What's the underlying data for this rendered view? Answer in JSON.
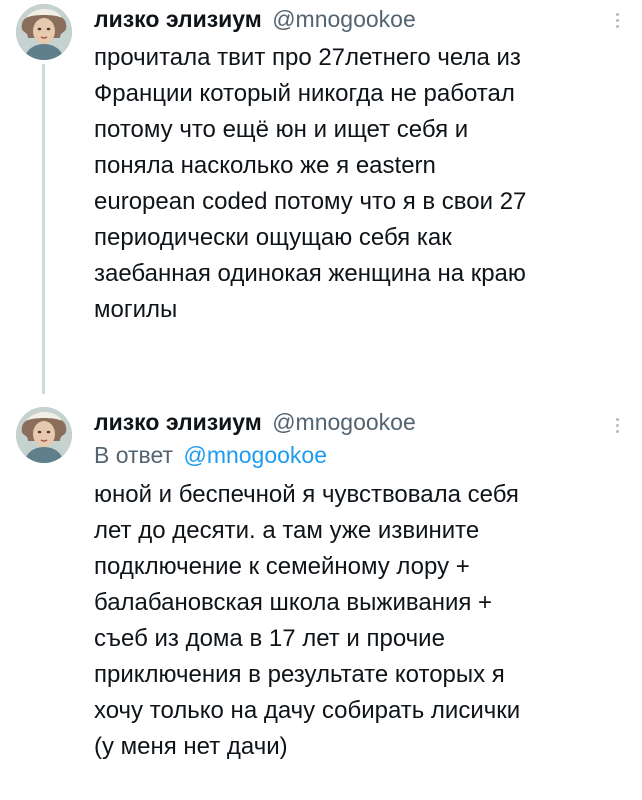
{
  "tweets": [
    {
      "display_name": "лизко элизиум",
      "handle": "@mnogookoe",
      "lines": [
        "прочитала твит про 27летнего чела из",
        "Франции который никогда не работал",
        "потому что ещё юн и ищет себя и",
        "поняла насколько же я eastern",
        "european coded потому что я в свои 27",
        "периодически ощущаю себя как",
        "заебанная одинокая женщина на краю",
        "могилы"
      ]
    },
    {
      "display_name": "лизко элизиум",
      "handle": "@mnogookoe",
      "reply_prefix": "В ответ",
      "reply_handle": "@mnogookoe",
      "lines": [
        "юной и беспечной я чувствовала себя",
        "лет до десяти. а там уже извините",
        "подключение к семейному лору +",
        "балабановская школа выживания +",
        "съеб из дома в 17 лет и прочие",
        "приключения в результате которых я",
        "хочу только на дачу собирать лисички",
        "(у меня нет дачи)"
      ]
    }
  ],
  "colors": {
    "text_primary": "#0f1419",
    "text_secondary": "#536471",
    "link": "#1d9bf0",
    "thread_line": "#cfd9de"
  },
  "icons": {
    "avatar": "user-avatar",
    "more": "more-options-icon"
  }
}
